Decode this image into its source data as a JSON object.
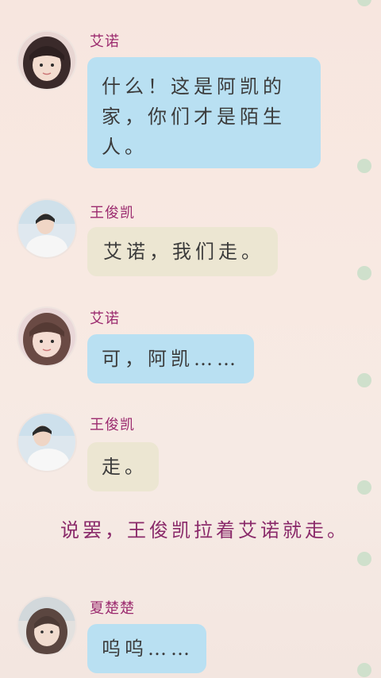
{
  "messages": [
    {
      "avatar": "avatar-girl-1",
      "name": "艾诺",
      "text": "什么！这是阿凯的家，你们才是陌生人。",
      "style": "blue"
    },
    {
      "avatar": "avatar-boy-1",
      "name": "王俊凯",
      "text": "艾诺，我们走。",
      "style": "beige"
    },
    {
      "avatar": "avatar-girl-2",
      "name": "艾诺",
      "text": "可，阿凯……",
      "style": "blue"
    },
    {
      "avatar": "avatar-boy-2",
      "name": "王俊凯",
      "text": "走。",
      "style": "beige"
    },
    {
      "avatar": "avatar-girl-3",
      "name": "夏楚楚",
      "text": "呜呜……",
      "style": "blue"
    }
  ],
  "narration": "说罢，王俊凯拉着艾诺就走。",
  "colors": {
    "name": "#9b2a6e",
    "bubble_blue": "#b9e0f2",
    "bubble_beige": "#ece6d2",
    "narration": "#8a2a6a",
    "rail_dot": "#cfe0cc"
  }
}
